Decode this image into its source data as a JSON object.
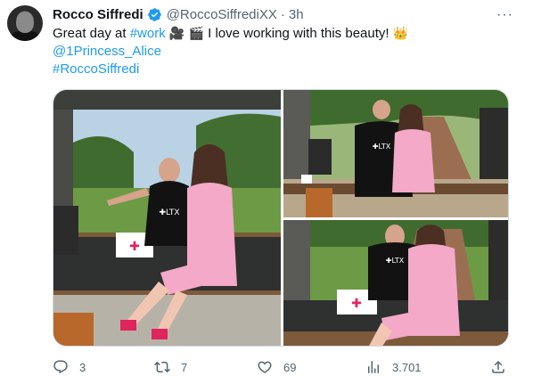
{
  "author": {
    "name": "Rocco Siffredi",
    "handle": "@RoccoSiffrediXX",
    "time": "3h",
    "verified_color": "#1d9bf0"
  },
  "tweet": {
    "text_prefix": "Great day at ",
    "hashtag_work": "#work",
    "text_mid": " I love working with this beauty!",
    "emoji_camera": "🎥",
    "emoji_clapper": "🎬",
    "emoji_crown": "👑",
    "mention": "@1Princess_Alice",
    "hashtag_name": "#RoccoSiffredi"
  },
  "media": {
    "shirt_text": "✚LTX"
  },
  "actions": {
    "reply_count": "3",
    "retweet_count": "7",
    "like_count": "69",
    "views_count": "3.701"
  },
  "colors": {
    "link": "#1d9bf0",
    "muted": "#536471"
  }
}
